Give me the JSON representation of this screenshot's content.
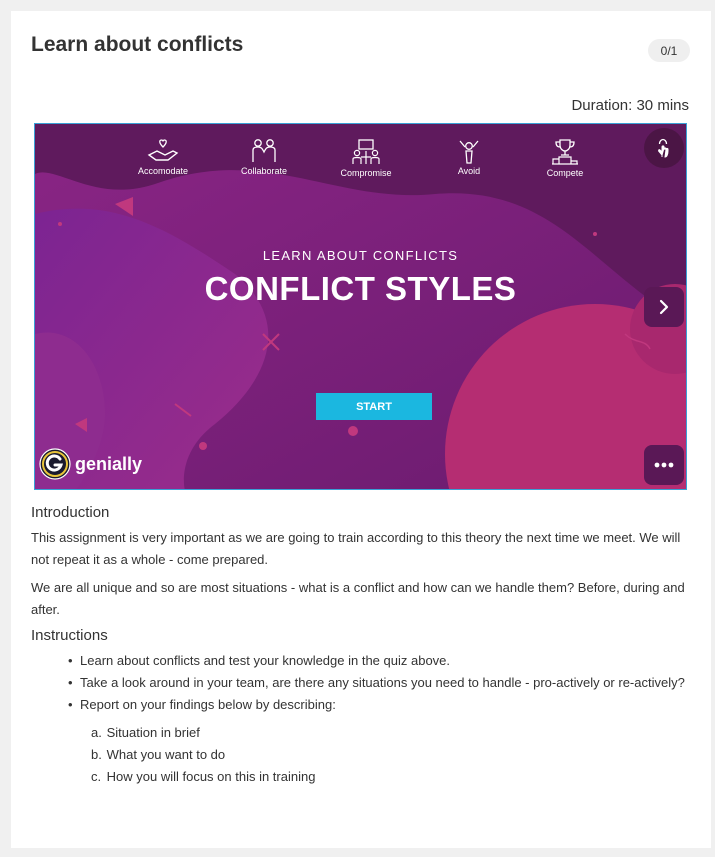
{
  "header": {
    "title": "Learn about conflicts",
    "score": "0/1",
    "duration": "Duration: 30 mins"
  },
  "embed": {
    "styles": [
      "Accomodate",
      "Collaborate",
      "Compromise",
      "Avoid",
      "Compete"
    ],
    "style_icons": [
      "handshake-heart-icon",
      "collaborate-people-icon",
      "compromise-table-icon",
      "avoid-person-icon",
      "compete-trophy-icon"
    ],
    "subtitle": "LEARN ABOUT CONFLICTS",
    "title": "CONFLICT STYLES",
    "start_label": "START",
    "brand": "genially",
    "colors": {
      "accent_start": "#1bb7e0",
      "slide_purple": "#7a1f7a",
      "slide_pink": "#b52d72",
      "border": "#3aa0d6"
    }
  },
  "intro": {
    "heading": "Introduction",
    "p1": "This assignment is very important as we are going to train according to this theory the next time we meet. We will not repeat it as a whole - come prepared.",
    "p2": "We are all unique and so are most situations - what is a conflict and how can we handle them? Before, during and after."
  },
  "instructions": {
    "heading": "Instructions",
    "bullets": [
      "Learn about conflicts and test your knowledge in the quiz above.",
      "Take a look around in your team, are there any situations you need to handle - pro-actively or re-actively?",
      "Report on your findings below by describing:"
    ],
    "steps": [
      {
        "marker": "a.",
        "text": "Situation in brief"
      },
      {
        "marker": "b.",
        "text": "What you want to do"
      },
      {
        "marker": "c.",
        "text": "How you will focus on this in training"
      }
    ]
  }
}
